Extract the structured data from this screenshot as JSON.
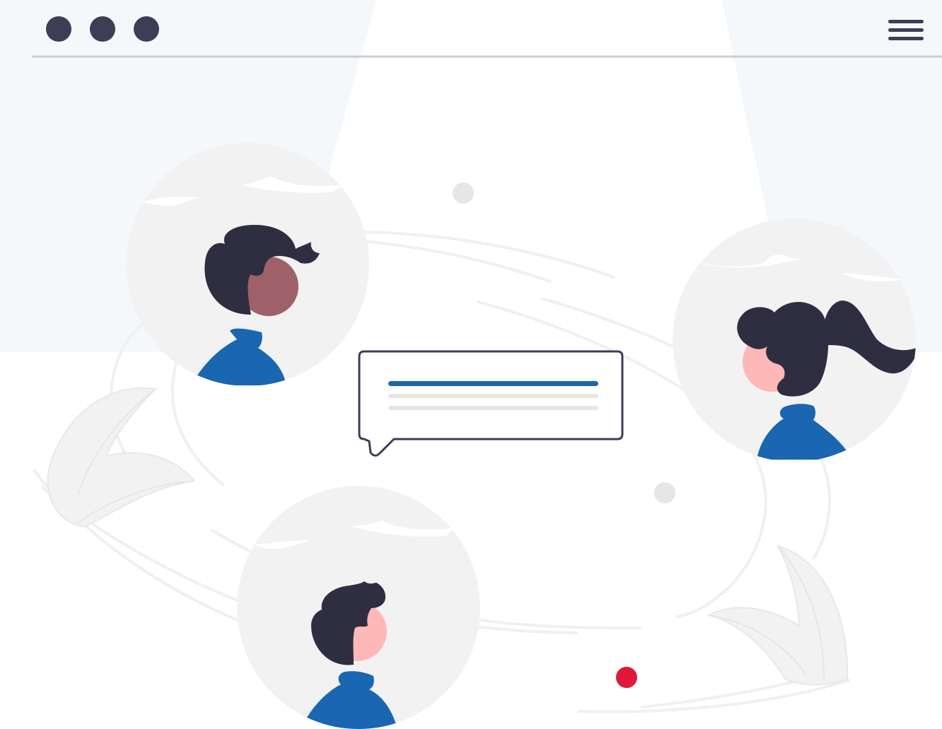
{
  "colors": {
    "dark": "#3f3d56",
    "hair": "#2f2e41",
    "accent": "#1a66b0",
    "notification": "#e0193c",
    "circle_bg": "#f2f2f2",
    "dot_gray": "#e6e6e6",
    "panel_bg": "#f5f8fb",
    "skin_dark": "#9e616a",
    "skin_light": "#ffb8b8",
    "line_gray": "#f0f0f0",
    "divider": "#cccccc"
  },
  "window_controls": [
    "dot-icon",
    "dot-icon",
    "dot-icon"
  ],
  "menu_icon": "hamburger-menu-icon",
  "avatars": [
    {
      "name": "avatar-man-dark-skin",
      "icon": "person-icon"
    },
    {
      "name": "avatar-woman-ponytail",
      "icon": "person-icon"
    },
    {
      "name": "avatar-man-light-skin",
      "icon": "person-icon"
    }
  ],
  "chat_bubble": {
    "icon": "speech-bubble-icon",
    "text_lines": 3
  },
  "decorations": [
    "leaf-icon",
    "leaf-icon",
    "gray-dot-icon",
    "gray-dot-icon",
    "red-dot-icon"
  ]
}
